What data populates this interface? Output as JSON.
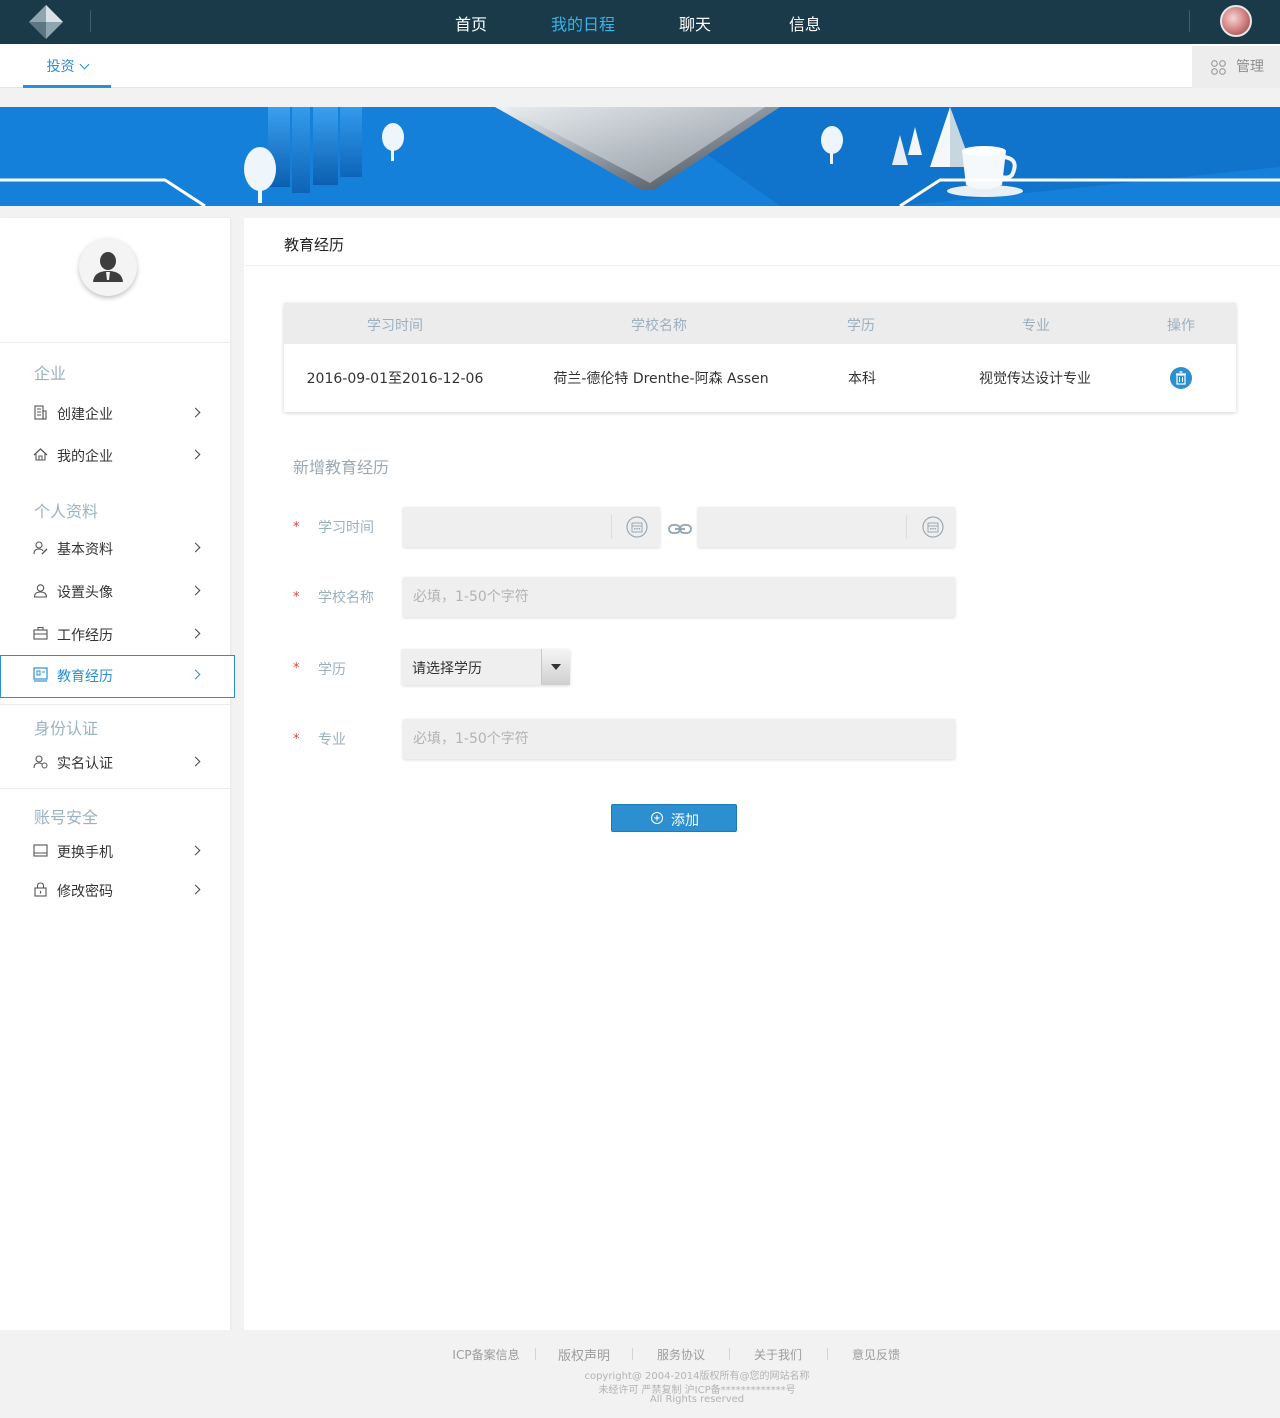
{
  "topnav": {
    "items": [
      {
        "label": "首页",
        "active": false
      },
      {
        "label": "我的日程",
        "active": true
      },
      {
        "label": "聊天",
        "active": false
      },
      {
        "label": "信息",
        "active": false
      }
    ]
  },
  "subnav": {
    "tab_label": "投资",
    "manage_label": "管理"
  },
  "sidebar": {
    "groups": [
      {
        "title": "企业",
        "items": [
          {
            "label": "创建企业",
            "icon": "building-icon"
          },
          {
            "label": "我的企业",
            "icon": "home-icon"
          }
        ]
      },
      {
        "title": "个人资料",
        "items": [
          {
            "label": "基本资料",
            "icon": "user-edit-icon"
          },
          {
            "label": "设置头像",
            "icon": "user-icon"
          },
          {
            "label": "工作经历",
            "icon": "briefcase-icon"
          },
          {
            "label": "教育经历",
            "icon": "book-icon",
            "active": true
          }
        ]
      },
      {
        "title": "身份认证",
        "items": [
          {
            "label": "实名认证",
            "icon": "user-verify-icon"
          }
        ]
      },
      {
        "title": "账号安全",
        "items": [
          {
            "label": "更换手机",
            "icon": "phone-icon"
          },
          {
            "label": "修改密码",
            "icon": "lock-icon"
          }
        ]
      }
    ]
  },
  "main": {
    "title": "教育经历",
    "table": {
      "headers": [
        "学习时间",
        "学校名称",
        "学历",
        "专业",
        "操作"
      ],
      "rows": [
        {
          "time": "2016-09-01至2016-12-06",
          "school": "荷兰-德伦特 Drenthe-阿森 Assen",
          "degree": "本科",
          "major": "视觉传达设计专业"
        }
      ]
    },
    "form": {
      "title": "新增教育经历",
      "required_mark": "*",
      "time_label": "学习时间",
      "school_label": "学校名称",
      "school_placeholder": "必填，1-50个字符",
      "degree_label": "学历",
      "degree_value": "请选择学历",
      "major_label": "专业",
      "major_placeholder": "必填，1-50个字符",
      "add_label": "添加"
    }
  },
  "footer": {
    "links": [
      "ICP备案信息",
      "版权声明",
      "服务协议",
      "关于我们",
      "意见反馈"
    ],
    "copyright": "copyright@ 2004-2014版权所有@您的网站名称",
    "license": "未经许可 严禁复制 沪ICP备*************号",
    "rights": "All Rights reserved"
  },
  "colors": {
    "nav_bg": "#1a3a49",
    "accent": "#2b8fd0",
    "nav_active": "#39b3e8",
    "required": "#e0413a"
  }
}
